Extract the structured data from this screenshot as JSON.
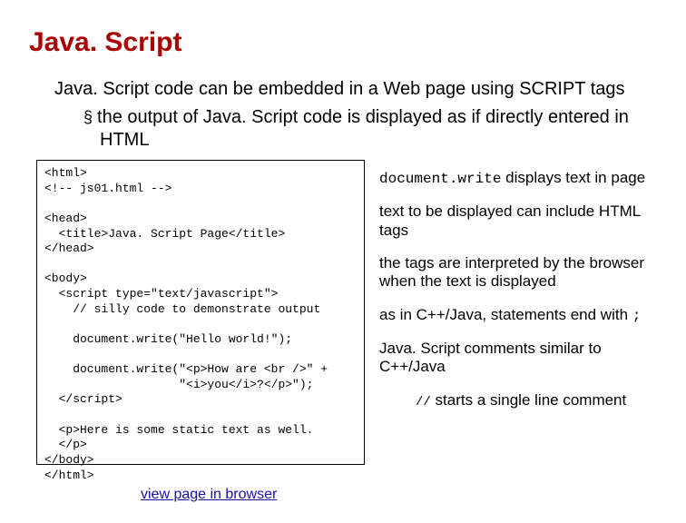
{
  "title": "Java. Script",
  "intro": "Java. Script code can be embedded in a Web page using SCRIPT tags",
  "bullet": "the output of Java. Script code is displayed as if directly entered in HTML",
  "code": "<html>\n<!-- js01.html -->\n\n<head>\n  <title>Java. Script Page</title>\n</head>\n\n<body>\n  <script type=\"text/javascript\">\n    // silly code to demonstrate output\n\n    document.write(\"Hello world!\");\n\n    document.write(\"<p>How are <br />\" +\n                   \"<i>you</i>?</p>\");\n  </scr+ipt>\n\n  <p>Here is some static text as well.\n  </p>\n</body>\n</html>",
  "right": {
    "item1a": "document.write",
    "item1b": " displays text in page",
    "item2": "text to be displayed can include HTML tags",
    "item3": "the tags are interpreted by the browser when the text is displayed",
    "item4a": "as in C++/Java, statements end with ",
    "item4b": ";",
    "item5": "Java. Script comments similar to C++/Java",
    "item6a": "//",
    "item6b": "   starts a single line comment"
  },
  "link": "view page in browser"
}
